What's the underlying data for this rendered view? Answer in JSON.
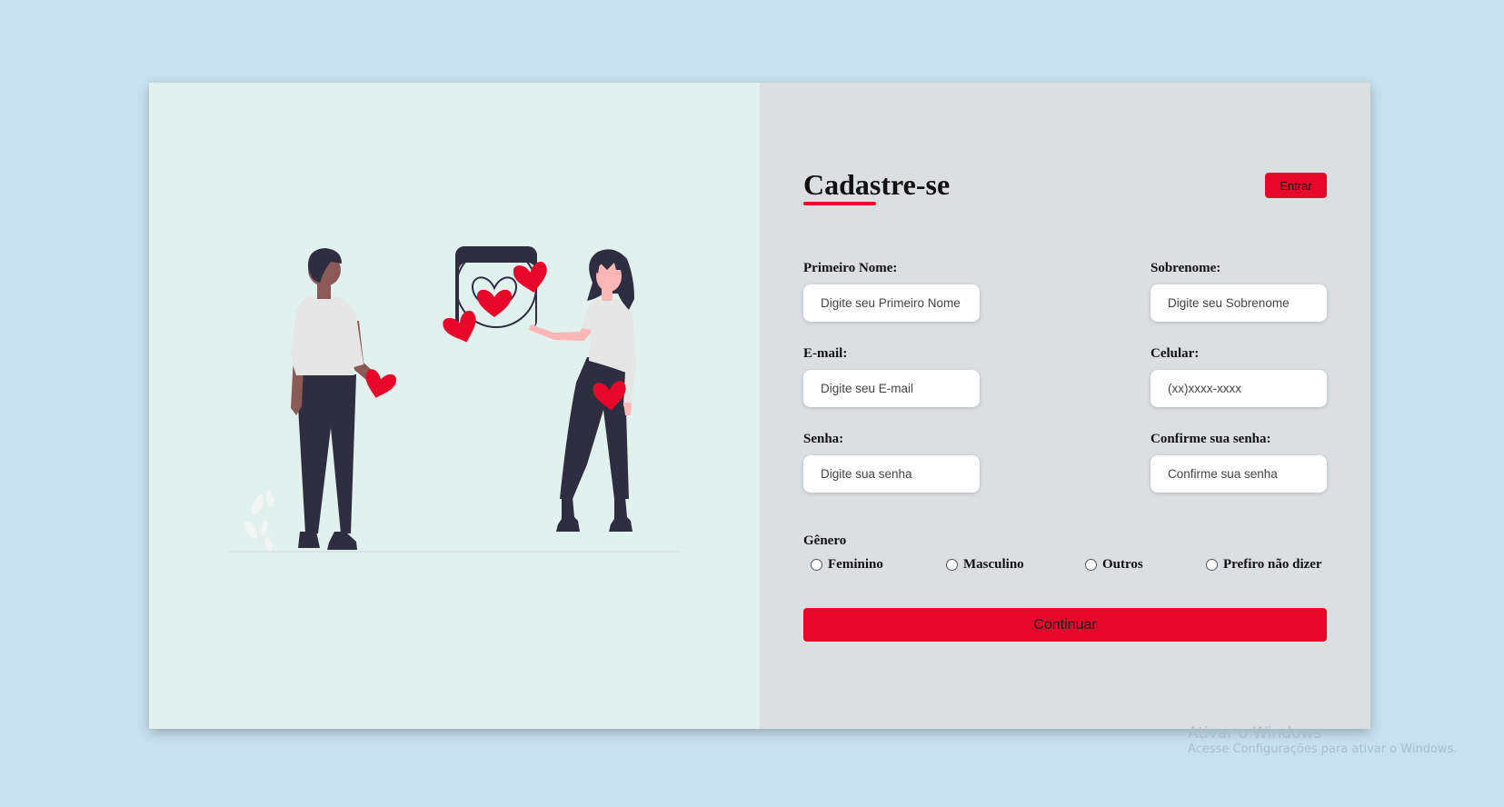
{
  "form": {
    "title": "Cadastre-se",
    "login_label": "Entrar",
    "fields": [
      {
        "label": "Primeiro Nome:",
        "placeholder": "Digite seu Primeiro Nome",
        "value": ""
      },
      {
        "label": "Sobrenome:",
        "placeholder": "Digite seu Sobrenome",
        "value": ""
      },
      {
        "label": "E-mail:",
        "placeholder": "Digite seu E-mail",
        "value": ""
      },
      {
        "label": "Celular:",
        "placeholder": "(xx)xxxx-xxxx",
        "value": ""
      },
      {
        "label": "Senha:",
        "placeholder": "Digite sua senha",
        "value": ""
      },
      {
        "label": "Confirme sua senha:",
        "placeholder": "Confirme sua senha",
        "value": ""
      }
    ],
    "gender": {
      "title": "Gênero",
      "options": [
        "Feminino",
        "Masculino",
        "Outros",
        "Prefiro não dizer"
      ],
      "selected": null
    },
    "continue_label": "Continuar"
  },
  "watermark": {
    "title": "Ativar o Windows",
    "subtitle": "Acesse Configurações para ativar o Windows."
  },
  "colors": {
    "page_background": "#c9e1ef",
    "illustration_background": "#e0f1ee",
    "form_background": "#dcdfe2",
    "accent": "#e8072a",
    "figure_dark": "#2f2e41",
    "shirt": "#e6e6e6"
  },
  "icons": {
    "illustration": "couple-hearts-illustration",
    "gender_radio": "radio-unchecked"
  }
}
